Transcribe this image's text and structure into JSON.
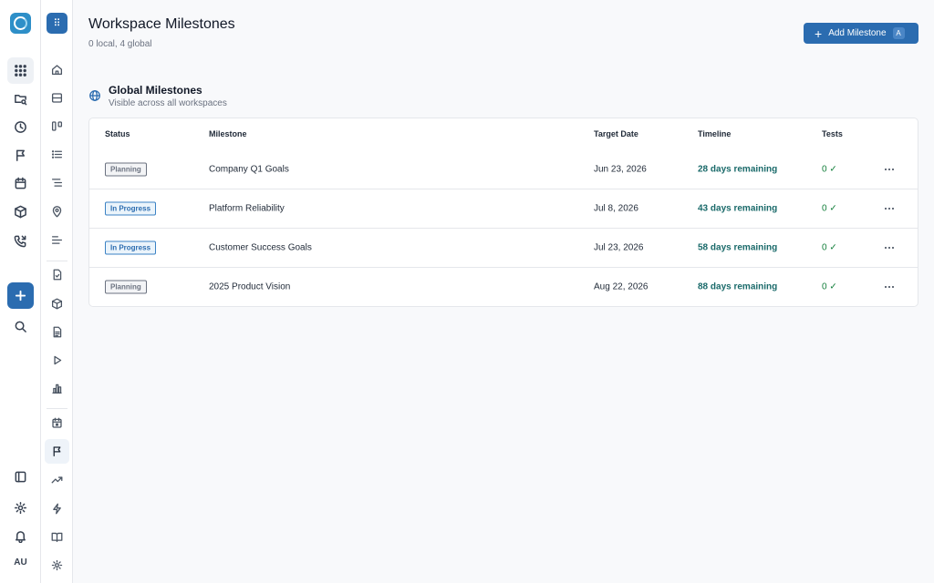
{
  "page": {
    "title": "Workspace Milestones",
    "subtitle": "0 local, 4 global",
    "add_button_label": "Add Milestone",
    "add_button_shortcut": "A"
  },
  "section": {
    "title": "Global Milestones",
    "subtitle": "Visible across all workspaces"
  },
  "table": {
    "headers": {
      "status": "Status",
      "milestone": "Milestone",
      "target": "Target Date",
      "timeline": "Timeline",
      "tests": "Tests"
    },
    "rows": [
      {
        "status": "Planning",
        "status_kind": "planning",
        "milestone": "Company Q1 Goals",
        "target": "Jun 23, 2026",
        "timeline": "28 days remaining",
        "tests": "0 ✓"
      },
      {
        "status": "In Progress",
        "status_kind": "progress",
        "milestone": "Platform Reliability",
        "target": "Jul 8, 2026",
        "timeline": "43 days remaining",
        "tests": "0 ✓"
      },
      {
        "status": "In Progress",
        "status_kind": "progress",
        "milestone": "Customer Success Goals",
        "target": "Jul 23, 2026",
        "timeline": "58 days remaining",
        "tests": "0 ✓"
      },
      {
        "status": "Planning",
        "status_kind": "planning",
        "milestone": "2025 Product Vision",
        "target": "Aug 22, 2026",
        "timeline": "88 days remaining",
        "tests": "0 ✓"
      }
    ]
  },
  "rail": {
    "avatar_initials": "AU"
  },
  "colors": {
    "accent": "#2b6cb0",
    "timeline": "#1a6a6a",
    "success": "#15803d"
  },
  "icons": {
    "rail": [
      "app-logo",
      "apps-grid-icon",
      "folder-search-icon",
      "clock-icon",
      "flag-icon",
      "calendar-icon",
      "package-icon",
      "phone-icon",
      "plus-icon",
      "search-icon",
      "panel-icon",
      "gear-icon",
      "bell-icon"
    ],
    "sub": [
      "home-icon",
      "layout-icon",
      "board-icon",
      "list-icon",
      "list-tree-icon",
      "map-pin-icon",
      "align-icon",
      "file-check-icon",
      "cube-icon",
      "document-icon",
      "play-icon",
      "bar-chart-icon",
      "calendar-icon",
      "flag-icon",
      "trending-icon",
      "lightning-icon",
      "book-icon",
      "gear-icon"
    ]
  }
}
